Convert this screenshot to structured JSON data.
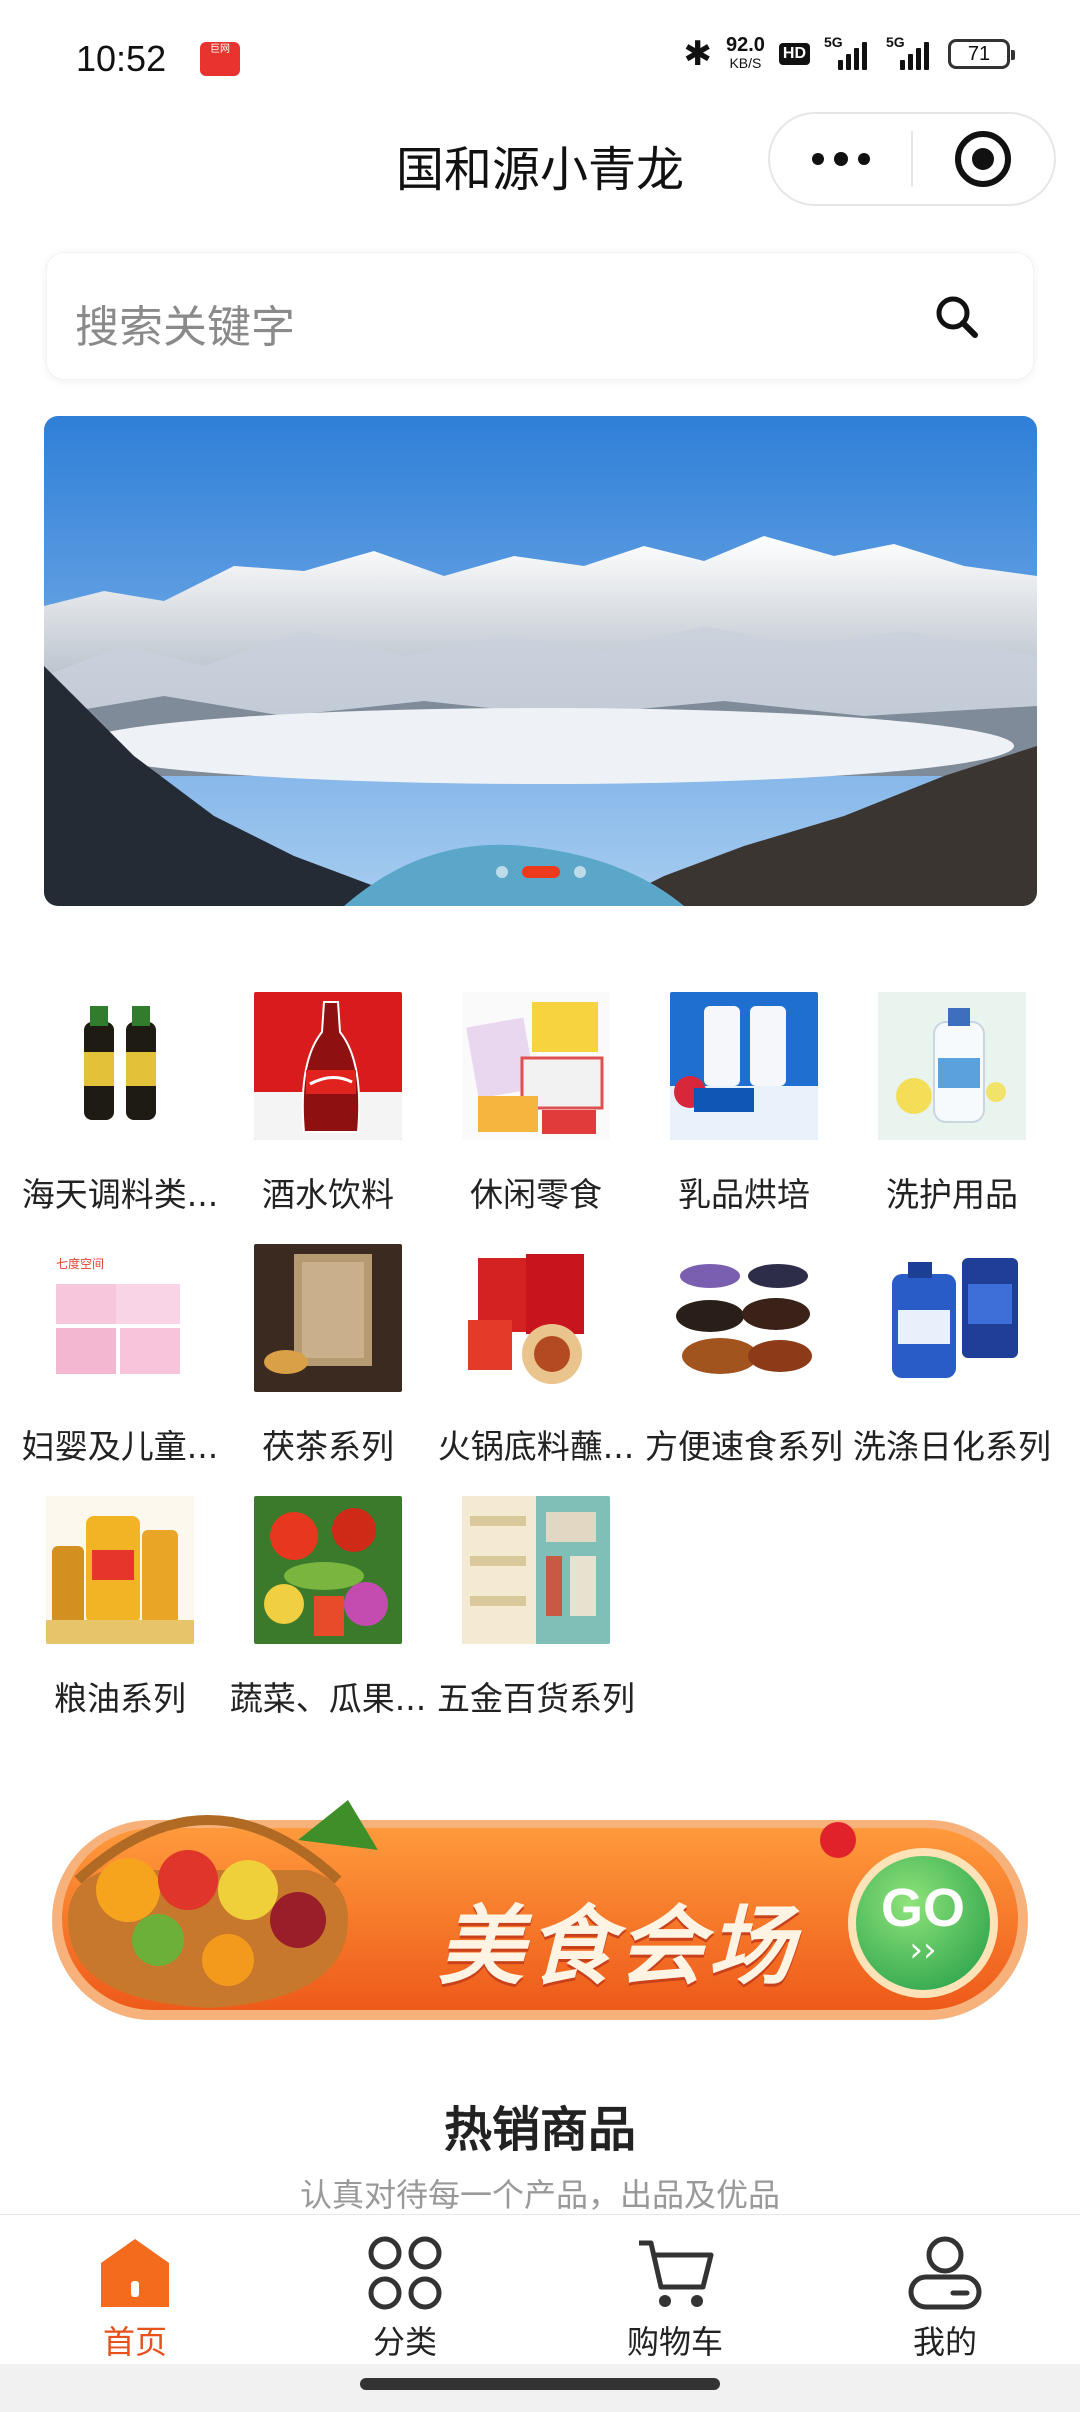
{
  "status_bar": {
    "time": "10:52",
    "app_badge": "巨网",
    "bluetooth_icon": "bluetooth-icon",
    "net_speed_value": "92.0",
    "net_speed_unit": "KB/S",
    "hd_badge": "HD",
    "signal1_label": "5G",
    "signal2_label": "5G",
    "battery": "71"
  },
  "header": {
    "title": "国和源小青龙",
    "more_icon": "more-dots-icon",
    "close_icon": "target-icon"
  },
  "search": {
    "placeholder": "搜索关键字",
    "icon": "search-icon"
  },
  "banner": {
    "slides": 3,
    "active_slide": 2,
    "colors": {
      "sky": "#3b8de0",
      "snow": "#f4f7fb",
      "rock": "#2c3440",
      "indicator": "#ee3a1c"
    }
  },
  "categories": [
    {
      "label": "海天调料类...",
      "icon": "soy-sauce-bottles-image"
    },
    {
      "label": "酒水饮料",
      "icon": "cola-bottle-image"
    },
    {
      "label": "休闲零食",
      "icon": "snacks-image"
    },
    {
      "label": "乳品烘培",
      "icon": "milk-strawberry-image"
    },
    {
      "label": "洗护用品",
      "icon": "shampoo-bottle-image"
    },
    {
      "label": "妇婴及儿童...",
      "icon": "baby-products-image"
    },
    {
      "label": "茯茶系列",
      "icon": "tea-brick-image"
    },
    {
      "label": "火锅底料蘸...",
      "icon": "hotpot-base-image"
    },
    {
      "label": "方便速食系列",
      "icon": "instant-food-bowls-image"
    },
    {
      "label": "洗涤日化系列",
      "icon": "detergent-image"
    },
    {
      "label": "粮油系列",
      "icon": "cooking-oil-image"
    },
    {
      "label": "蔬菜、瓜果...",
      "icon": "vegetables-image"
    },
    {
      "label": "五金百货系列",
      "icon": "hardware-store-image"
    }
  ],
  "promo": {
    "text": "美食会场",
    "go_label": "GO",
    "go_arrows": "››",
    "colors": {
      "bg": "#f27a2a",
      "go": "#2fb24c"
    }
  },
  "hot": {
    "title": "热销商品",
    "subtitle": "认真对待每一个产品，出品及优品"
  },
  "tabbar": {
    "items": [
      {
        "label": "首页",
        "icon": "home-icon",
        "active": true
      },
      {
        "label": "分类",
        "icon": "category-icon",
        "active": false
      },
      {
        "label": "购物车",
        "icon": "cart-icon",
        "active": false
      },
      {
        "label": "我的",
        "icon": "profile-icon",
        "active": false
      }
    ],
    "active_color": "#e8501c"
  }
}
